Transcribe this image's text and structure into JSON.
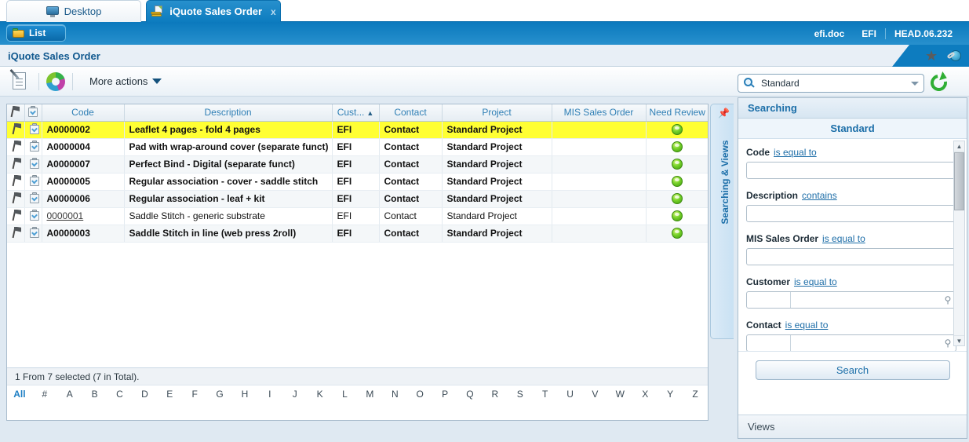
{
  "tabs": [
    {
      "label": "Desktop",
      "icon": "monitor-icon",
      "active": false
    },
    {
      "label": "iQuote Sales Order",
      "icon": "quote-icon",
      "active": true,
      "close": "x"
    }
  ],
  "toolbar": {
    "list_button": "List",
    "list_icon": "folder-icon",
    "env": {
      "doc": "efi.doc",
      "org": "EFI",
      "build": "HEAD.06.232"
    }
  },
  "breadcrumb": {
    "title": "iQuote Sales Order",
    "star_icon": "star-icon",
    "globe_icon": "globe-link-icon"
  },
  "actionbar": {
    "edit_icon": "edit-document-icon",
    "refresh_icon": "circular-refresh-icon",
    "more_actions": "More actions"
  },
  "grid": {
    "columns": [
      {
        "key": "flag",
        "label": "",
        "icon": "flag-icon"
      },
      {
        "key": "clip",
        "label": "",
        "icon": "clipboard-icon"
      },
      {
        "key": "code",
        "label": "Code"
      },
      {
        "key": "description",
        "label": "Description"
      },
      {
        "key": "customer",
        "label": "Cust...",
        "sorted": "asc",
        "sort_glyph": "▲"
      },
      {
        "key": "contact",
        "label": "Contact"
      },
      {
        "key": "project",
        "label": "Project"
      },
      {
        "key": "mis",
        "label": "MIS Sales Order"
      },
      {
        "key": "review",
        "label": "Need Review"
      }
    ],
    "rows": [
      {
        "code": "A0000002",
        "description": "Leaflet 4 pages - fold 4 pages",
        "customer": "EFI",
        "contact": "Contact",
        "project": "Standard Project",
        "mis": "",
        "review": "green",
        "selected": true,
        "link": false
      },
      {
        "code": "A0000004",
        "description": "Pad with wrap-around cover (separate funct)",
        "customer": "EFI",
        "contact": "Contact",
        "project": "Standard Project",
        "mis": "",
        "review": "green",
        "selected": false,
        "link": false
      },
      {
        "code": "A0000007",
        "description": "Perfect Bind - Digital (separate funct)",
        "customer": "EFI",
        "contact": "Contact",
        "project": "Standard Project",
        "mis": "",
        "review": "green",
        "selected": false,
        "link": false
      },
      {
        "code": "A0000005",
        "description": "Regular association - cover - saddle stitch",
        "customer": "EFI",
        "contact": "Contact",
        "project": "Standard Project",
        "mis": "",
        "review": "green",
        "selected": false,
        "link": false
      },
      {
        "code": "A0000006",
        "description": "Regular association - leaf + kit",
        "customer": "EFI",
        "contact": "Contact",
        "project": "Standard Project",
        "mis": "",
        "review": "green",
        "selected": false,
        "link": false
      },
      {
        "code": "0000001",
        "description": "Saddle Stitch - generic substrate",
        "customer": "EFI",
        "contact": "Contact",
        "project": "Standard Project",
        "mis": "",
        "review": "green",
        "selected": false,
        "link": true,
        "muted": true
      },
      {
        "code": "A0000003",
        "description": "Saddle Stitch in line (web press 2roll)",
        "customer": "EFI",
        "contact": "Contact",
        "project": "Standard Project",
        "mis": "",
        "review": "green",
        "selected": false,
        "link": false
      }
    ],
    "status": "1 From 7 selected (7 in Total).",
    "alphabet": [
      "All",
      "#",
      "A",
      "B",
      "C",
      "D",
      "E",
      "F",
      "G",
      "H",
      "I",
      "J",
      "K",
      "L",
      "M",
      "N",
      "O",
      "P",
      "Q",
      "R",
      "S",
      "T",
      "U",
      "V",
      "W",
      "X",
      "Y",
      "Z"
    ],
    "alphabet_active": "All"
  },
  "sidetab": {
    "label": "Searching & Views",
    "pin_icon": "pin-icon"
  },
  "panel": {
    "selector": {
      "value": "Standard",
      "icon": "magnifier-icon",
      "chevron": "chevron-down-icon"
    },
    "refresh_icon": "refresh-arrow-icon",
    "header": "Searching",
    "subheader": "Standard",
    "fields": [
      {
        "label": "Code",
        "operator": "is equal to",
        "value": "",
        "lookup": false
      },
      {
        "label": "Description",
        "operator": "contains",
        "value": "",
        "lookup": false
      },
      {
        "label": "MIS Sales Order",
        "operator": "is equal to",
        "value": "",
        "lookup": false
      },
      {
        "label": "Customer",
        "operator": "is equal to",
        "value": "",
        "lookup": true,
        "lookup_icon": "search-lookup-icon"
      },
      {
        "label": "Contact",
        "operator": "is equal to",
        "value": "",
        "lookup": true,
        "lookup_icon": "search-lookup-icon"
      }
    ],
    "scroll": {
      "up": "▲",
      "down": "▼"
    },
    "search_button": "Search",
    "views": "Views"
  },
  "colors": {
    "accent_blue": "#0d7cbf",
    "link_blue": "#1e7fc4",
    "selected_row": "#ffff33",
    "status_green": "#77d22a"
  }
}
